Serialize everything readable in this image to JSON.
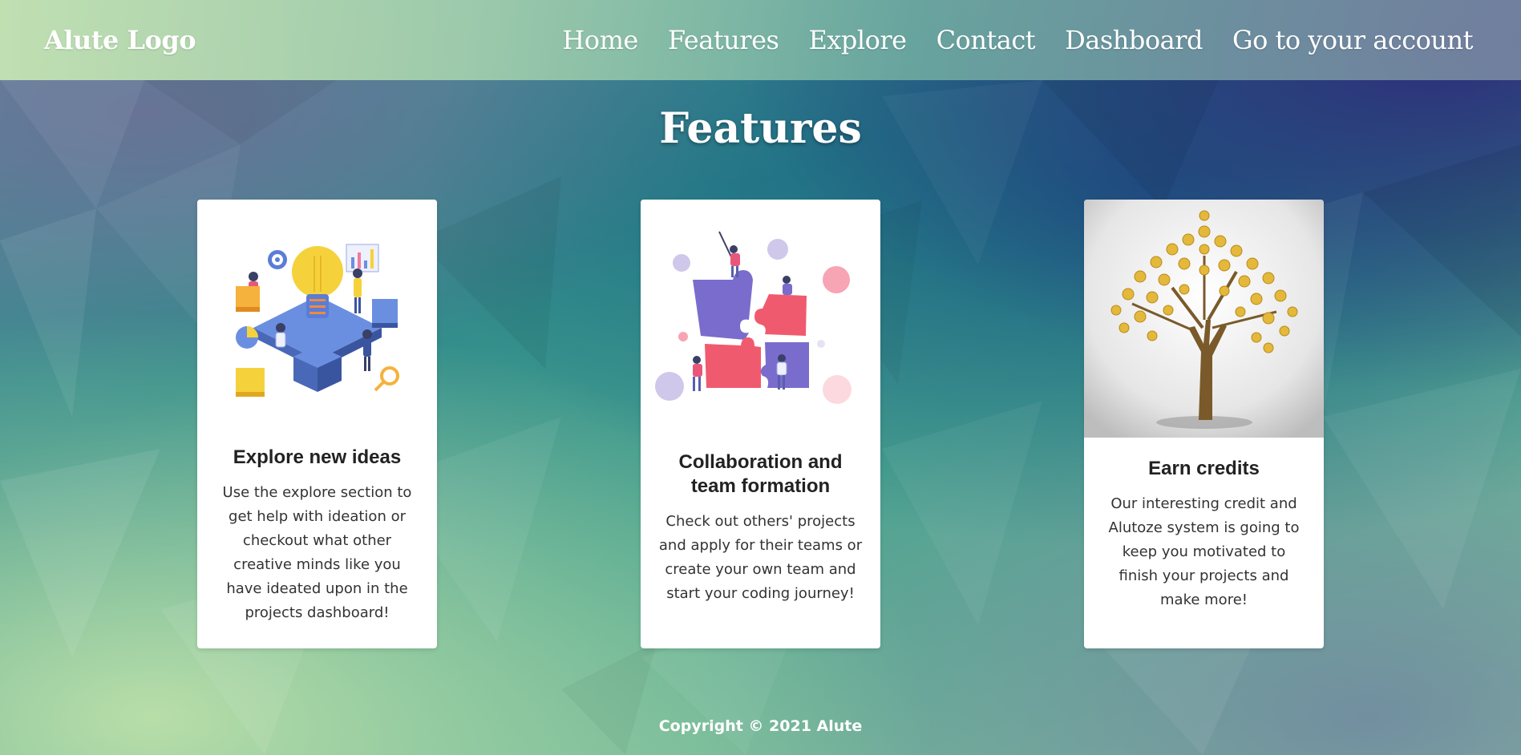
{
  "navbar": {
    "brand": "Alute Logo",
    "links": [
      {
        "label": "Home"
      },
      {
        "label": "Features"
      },
      {
        "label": "Explore"
      },
      {
        "label": "Contact"
      },
      {
        "label": "Dashboard"
      },
      {
        "label": "Go to your account"
      }
    ]
  },
  "main": {
    "title": "Features",
    "cards": [
      {
        "title": "Explore new ideas",
        "text": "Use the explore section to get help with ideation or checkout what other creative minds like you have ideated upon in the projects dashboard!",
        "image": "ideas-illustration"
      },
      {
        "title": "Collaboration and team formation",
        "text": "Check out others' projects and apply for their teams or create your own team and start your coding journey!",
        "image": "puzzle-team-illustration"
      },
      {
        "title": "Earn credits",
        "text": "Our interesting credit and Alutoze system is going to keep you motivated to finish your projects and make more!",
        "image": "money-tree-photo"
      }
    ]
  },
  "footer": {
    "copyright": "Copyright © 2021 Alute"
  }
}
